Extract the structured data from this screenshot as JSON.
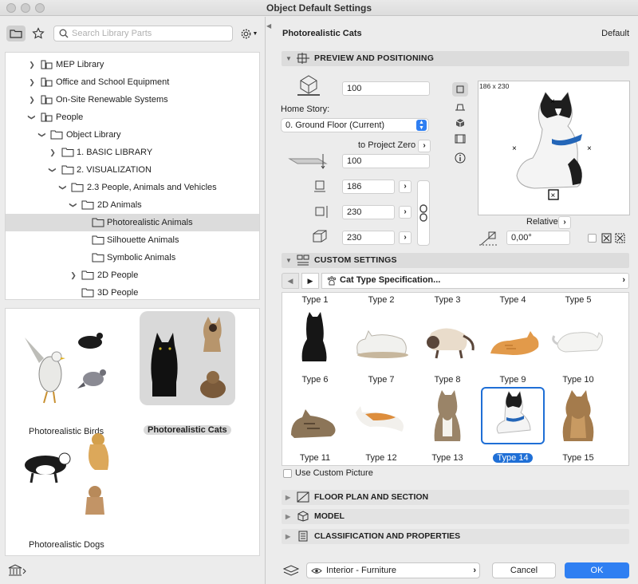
{
  "window": {
    "title": "Object Default Settings"
  },
  "library": {
    "search_placeholder": "Search Library Parts",
    "tree": [
      {
        "label": "MEP Library",
        "level": 1,
        "expanded": false
      },
      {
        "label": "Office and School Equipment",
        "level": 1,
        "expanded": false
      },
      {
        "label": "On-Site Renewable Systems",
        "level": 1,
        "expanded": false
      },
      {
        "label": "People",
        "level": 1,
        "expanded": true
      },
      {
        "label": "Object Library",
        "level": 2,
        "expanded": true
      },
      {
        "label": "1. BASIC LIBRARY",
        "level": 3,
        "expanded": false
      },
      {
        "label": "2. VISUALIZATION",
        "level": 3,
        "expanded": true
      },
      {
        "label": "2.3 People, Animals and Vehicles",
        "level": 4,
        "expanded": true
      },
      {
        "label": "2D Animals",
        "level": 5,
        "expanded": true
      },
      {
        "label": "Photorealistic Animals",
        "level": 6,
        "selected": true
      },
      {
        "label": "Silhouette Animals",
        "level": 6
      },
      {
        "label": "Symbolic Animals",
        "level": 6
      },
      {
        "label": "2D People",
        "level": 5,
        "expanded": false
      },
      {
        "label": "3D People",
        "level": 5
      }
    ],
    "gallery": [
      {
        "label": "Photorealistic Birds"
      },
      {
        "label": "Photorealistic Cats",
        "selected": true
      },
      {
        "label": "Photorealistic Dogs"
      }
    ]
  },
  "settings": {
    "object_name": "Photorealistic Cats",
    "default_label": "Default",
    "preview_section": {
      "title": "PREVIEW AND POSITIONING",
      "elevation": "100",
      "home_story_label": "Home Story:",
      "home_story_value": "0. Ground Floor (Current)",
      "to_project_zero": "to Project Zero",
      "project_zero_value": "100",
      "width": "186",
      "height": "230",
      "depth": "230",
      "preview_size": "186 x 230",
      "relative_label": "Relative",
      "angle": "0,00°"
    },
    "custom_section": {
      "title": "CUSTOM SETTINGS",
      "page_title": "Cat Type Specification...",
      "type_labels_top": [
        "Type 1",
        "Type 2",
        "Type 3",
        "Type 4",
        "Type 5"
      ],
      "type_labels_mid": [
        "Type 6",
        "Type 7",
        "Type 8",
        "Type 9",
        "Type 10"
      ],
      "type_labels_bot": [
        "Type 11",
        "Type 12",
        "Type 13",
        "Type 14",
        "Type 15"
      ],
      "selected_type": "Type 14",
      "use_custom_picture": "Use Custom Picture"
    },
    "floor_plan_title": "FLOOR PLAN AND SECTION",
    "model_title": "MODEL",
    "classification_title": "CLASSIFICATION AND PROPERTIES",
    "layer_value": "Interior - Furniture",
    "cancel_label": "Cancel",
    "ok_label": "OK"
  },
  "colors": {
    "accent": "#2f7ff2",
    "selection": "#1f6fd6"
  }
}
